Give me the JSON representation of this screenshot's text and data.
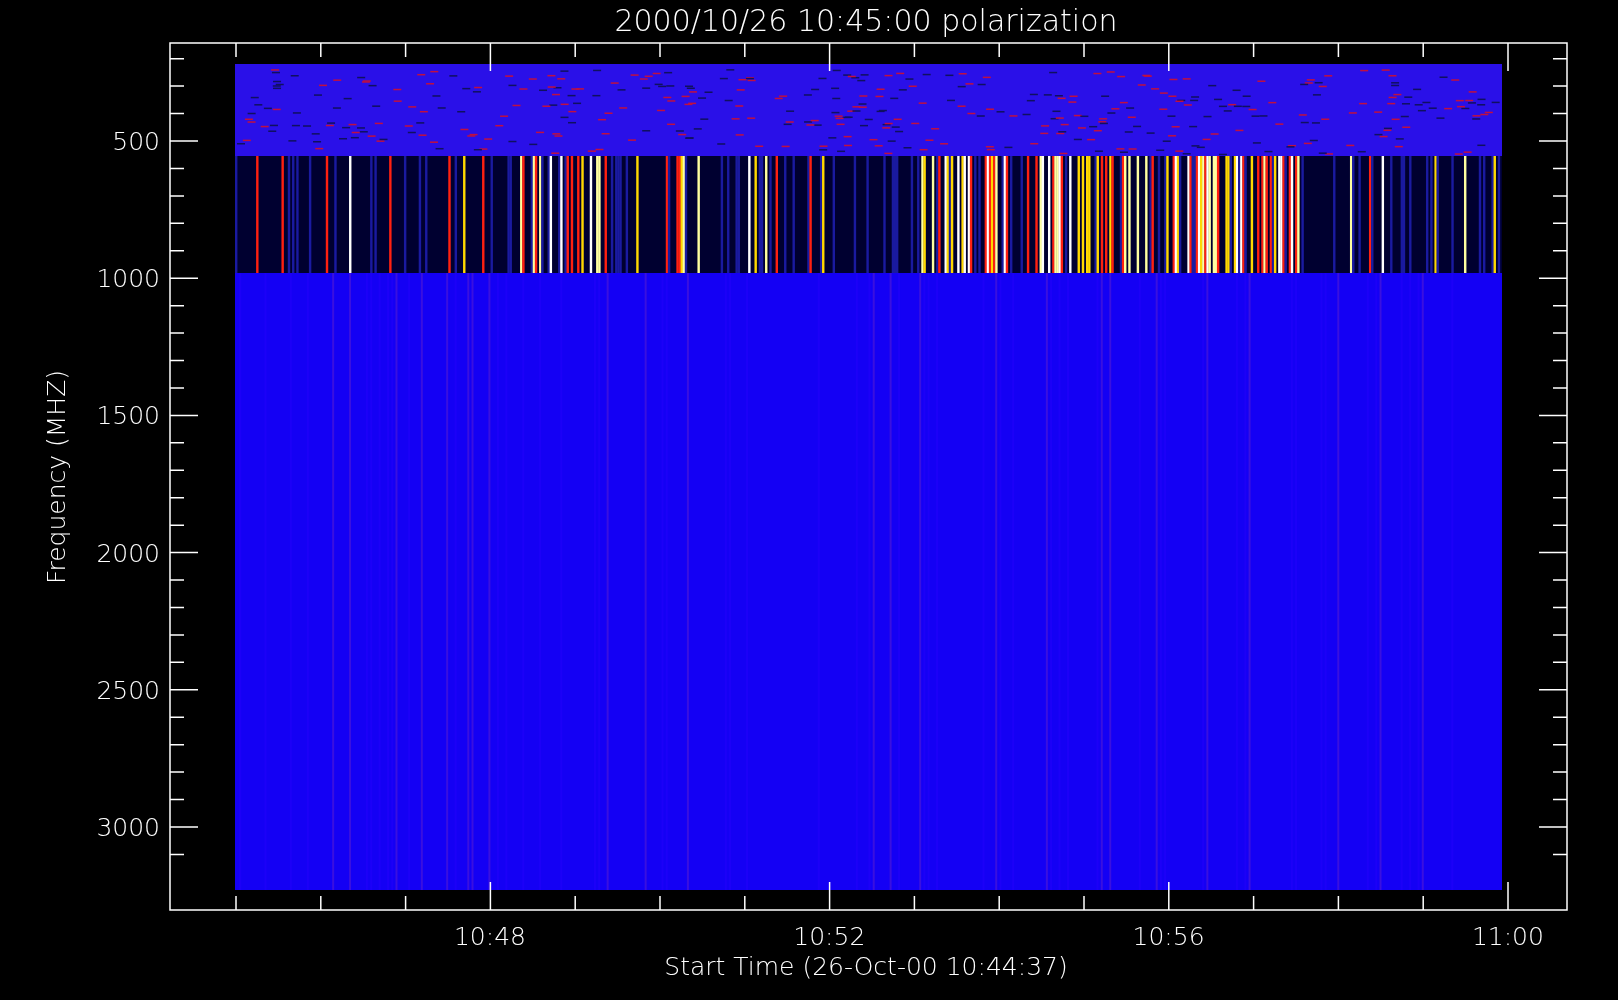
{
  "title": "2000/10/26 10:45:00 polarization",
  "y_axis": {
    "label": "Frequency (MHZ)",
    "ticks": [
      "500",
      "1000",
      "1500",
      "2000",
      "2500",
      "3000"
    ]
  },
  "x_axis": {
    "label": "Start Time (26-Oct-00 10:44:37)",
    "ticks": [
      "10:48",
      "10:52",
      "10:56",
      "11:00"
    ]
  }
}
